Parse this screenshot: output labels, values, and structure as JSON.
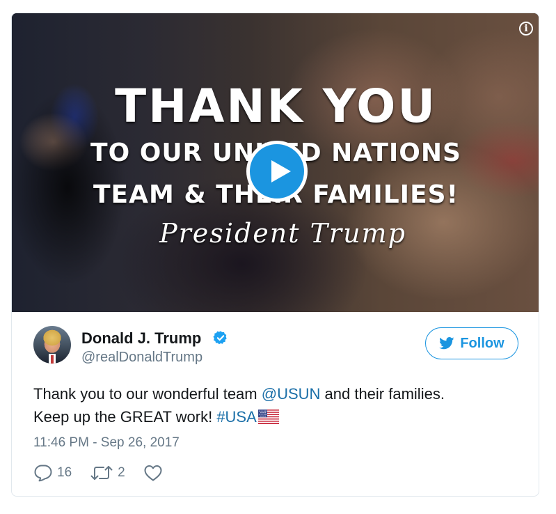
{
  "media": {
    "overlay_line1": "THANK YOU",
    "overlay_line2": "TO OUR UNITED NATIONS",
    "overlay_line3": "TEAM & THEIR FAMILIES!",
    "overlay_signature": "President Trump",
    "info_glyph": "i",
    "play_icon": "play-icon"
  },
  "author": {
    "name": "Donald J. Trump",
    "handle": "@realDonaldTrump",
    "verified": true
  },
  "follow": {
    "label": "Follow"
  },
  "tweet": {
    "text_before_mention": "Thank you to our wonderful team ",
    "mention": "@USUN",
    "text_after_mention": " and their families.",
    "line2_text": "Keep up the GREAT work! ",
    "hashtag": "#USA",
    "emoji": "flag-us-icon",
    "timestamp": "11:46 PM - Sep 26, 2017"
  },
  "actions": {
    "replies": "16",
    "retweets": "2"
  },
  "colors": {
    "accent": "#1b95e0",
    "link": "#1b6fa8",
    "text": "#14171a",
    "muted": "#657786",
    "border": "#e1e8ed"
  }
}
